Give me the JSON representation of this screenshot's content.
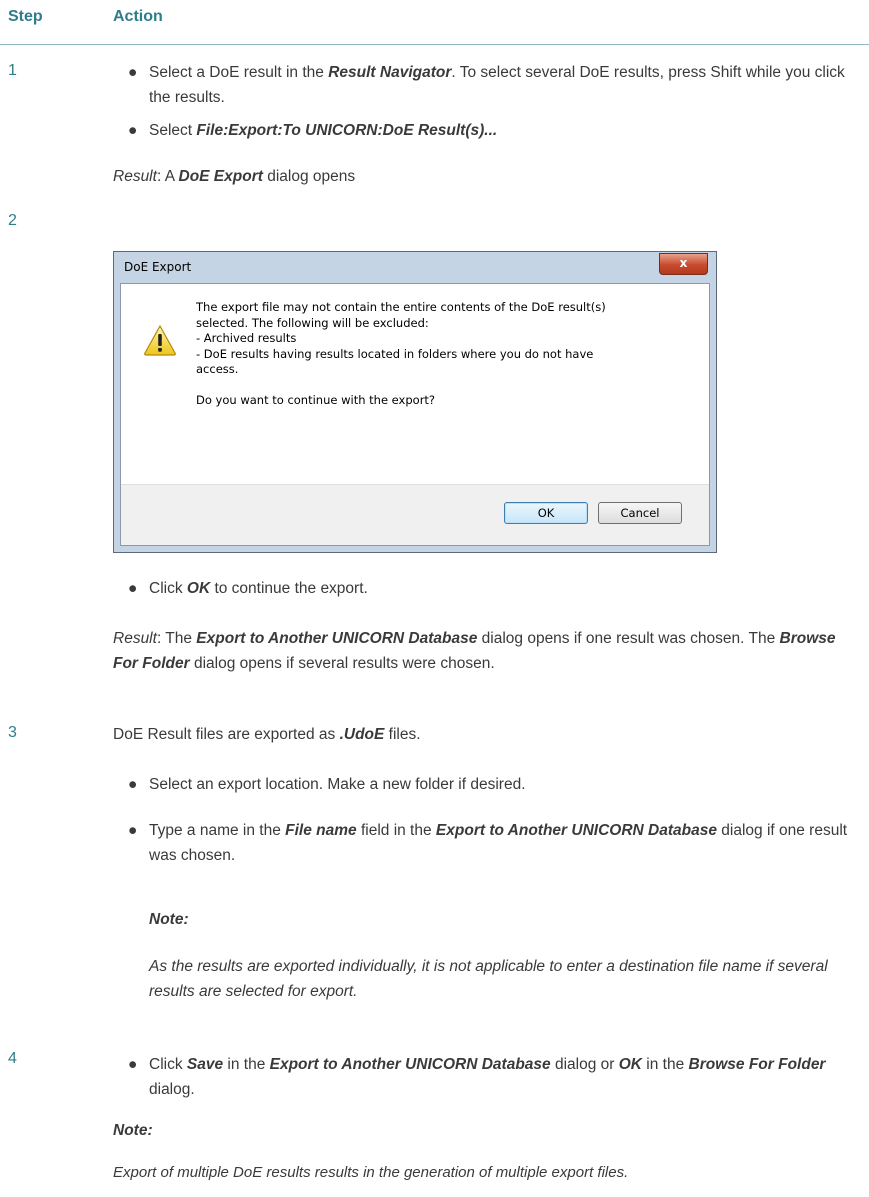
{
  "header": {
    "step": "Step",
    "action": "Action"
  },
  "steps": [
    {
      "num": "1"
    },
    {
      "num": "2"
    },
    {
      "num": "3"
    },
    {
      "num": "4"
    }
  ],
  "step1": {
    "b1_pre": "Select a DoE result in the ",
    "b1_em": "Result Navigator",
    "b1_post": ". To select several DoE results, press Shift while you click the results.",
    "b2_pre": "Select ",
    "b2_em": "File:Export:To UNICORN:DoE Result(s)...",
    "result_label": "Result",
    "result_pre": ": A ",
    "result_em": "DoE Export",
    "result_post": " dialog opens"
  },
  "dialog": {
    "title": "DoE Export",
    "close_glyph": "x",
    "lines": [
      "The export file may not contain the entire contents of the DoE result(s)",
      "selected. The following will be excluded:",
      "- Archived results",
      "- DoE results having results located in folders where you do not have",
      "access.",
      "",
      "Do you want to continue with the export?"
    ],
    "ok_label": "OK",
    "cancel_label": "Cancel"
  },
  "step2": {
    "b1_pre": "Click ",
    "b1_em": "OK",
    "b1_post": " to continue the export.",
    "result_label": "Result",
    "result_pre": ": The ",
    "result_em1": "Export to Another UNICORN Database",
    "result_mid": " dialog opens if one result was chosen. The ",
    "result_em2": "Browse For Folder",
    "result_post": " dialog opens if several results were chosen."
  },
  "step3": {
    "intro_pre": "DoE Result files are exported as ",
    "intro_em": ".UdoE",
    "intro_post": " files.",
    "b1": "Select an export location. Make a new folder if desired.",
    "b2_pre": "Type a name in the ",
    "b2_em1": "File name",
    "b2_mid": " field in the ",
    "b2_em2": "Export to Another UNICORN Database",
    "b2_post": " dialog if one result was chosen.",
    "note_title": "Note:",
    "note_body": "As the results are exported individually, it is not applicable to enter a destination file name if several results are selected for export."
  },
  "step4": {
    "b1_pre": "Click ",
    "b1_em1": "Save",
    "b1_mid1": " in the ",
    "b1_em2": "Export to Another UNICORN Database",
    "b1_mid2": " dialog or ",
    "b1_em3": "OK",
    "b1_mid3": " in the ",
    "b1_em4": "Browse For Folder",
    "b1_post": " dialog.",
    "note_title": "Note:",
    "note_body": "Export of multiple DoE results results in the generation of multiple export files."
  },
  "colors": {
    "accent": "#2f7d8c",
    "rule": "#8fb8c4"
  }
}
